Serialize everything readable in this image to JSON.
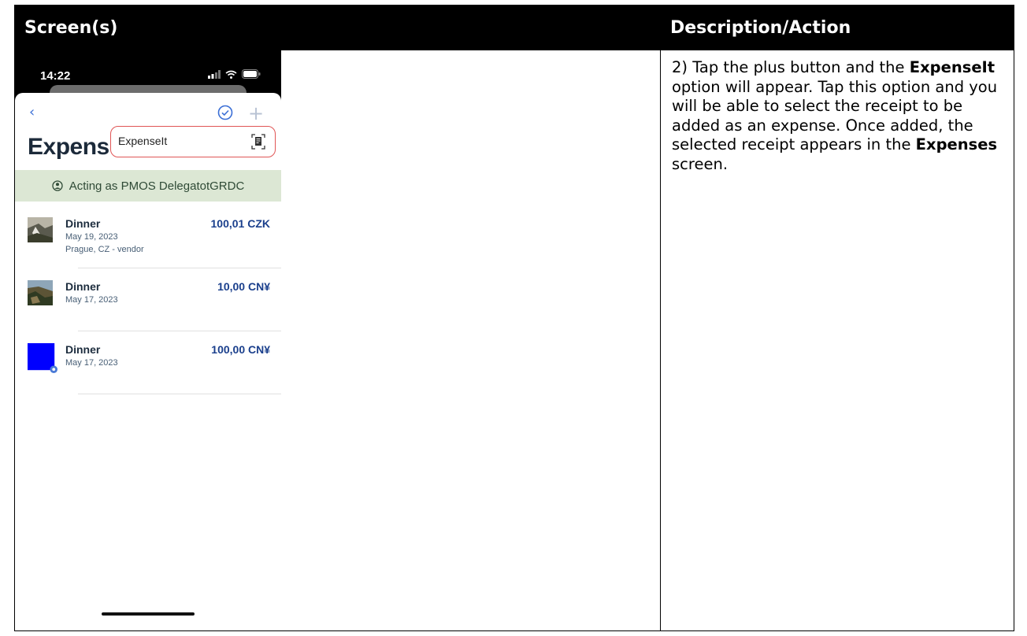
{
  "table": {
    "header_screens": "Screen(s)",
    "header_description": "Description/Action"
  },
  "description": {
    "part1": "2) Tap the plus button and the ",
    "bold1": "ExpenseIt",
    "part2": " option will appear. Tap this option and you will be able to select the receipt to be added as an expense. Once added, the selected receipt appears in the ",
    "bold2": "Expenses",
    "part3": " screen."
  },
  "phone": {
    "time": "14:22",
    "title": "Expens",
    "popup_label": "ExpenseIt",
    "acting_banner": "Acting as PMOS DelegatotGRDC",
    "expenses": [
      {
        "name": "Dinner",
        "date": "May 19, 2023",
        "location": "Prague, CZ - vendor",
        "amount": "100,01 CZK"
      },
      {
        "name": "Dinner",
        "date": "May 17, 2023",
        "location": "",
        "amount": "10,00 CN¥"
      },
      {
        "name": "Dinner",
        "date": "May 17, 2023",
        "location": "",
        "amount": "100,00 CN¥"
      }
    ]
  },
  "icons": {
    "back": "chevron-left-icon",
    "submit": "check-circle-icon",
    "add": "plus-icon",
    "scan": "scan-receipt-icon",
    "user": "user-circle-icon"
  },
  "colors": {
    "accent": "#3b6fd6",
    "amount": "#1a3f8c",
    "banner_bg": "#dce7d4",
    "popup_border": "#e05555",
    "third_thumb": "#0000ff"
  }
}
